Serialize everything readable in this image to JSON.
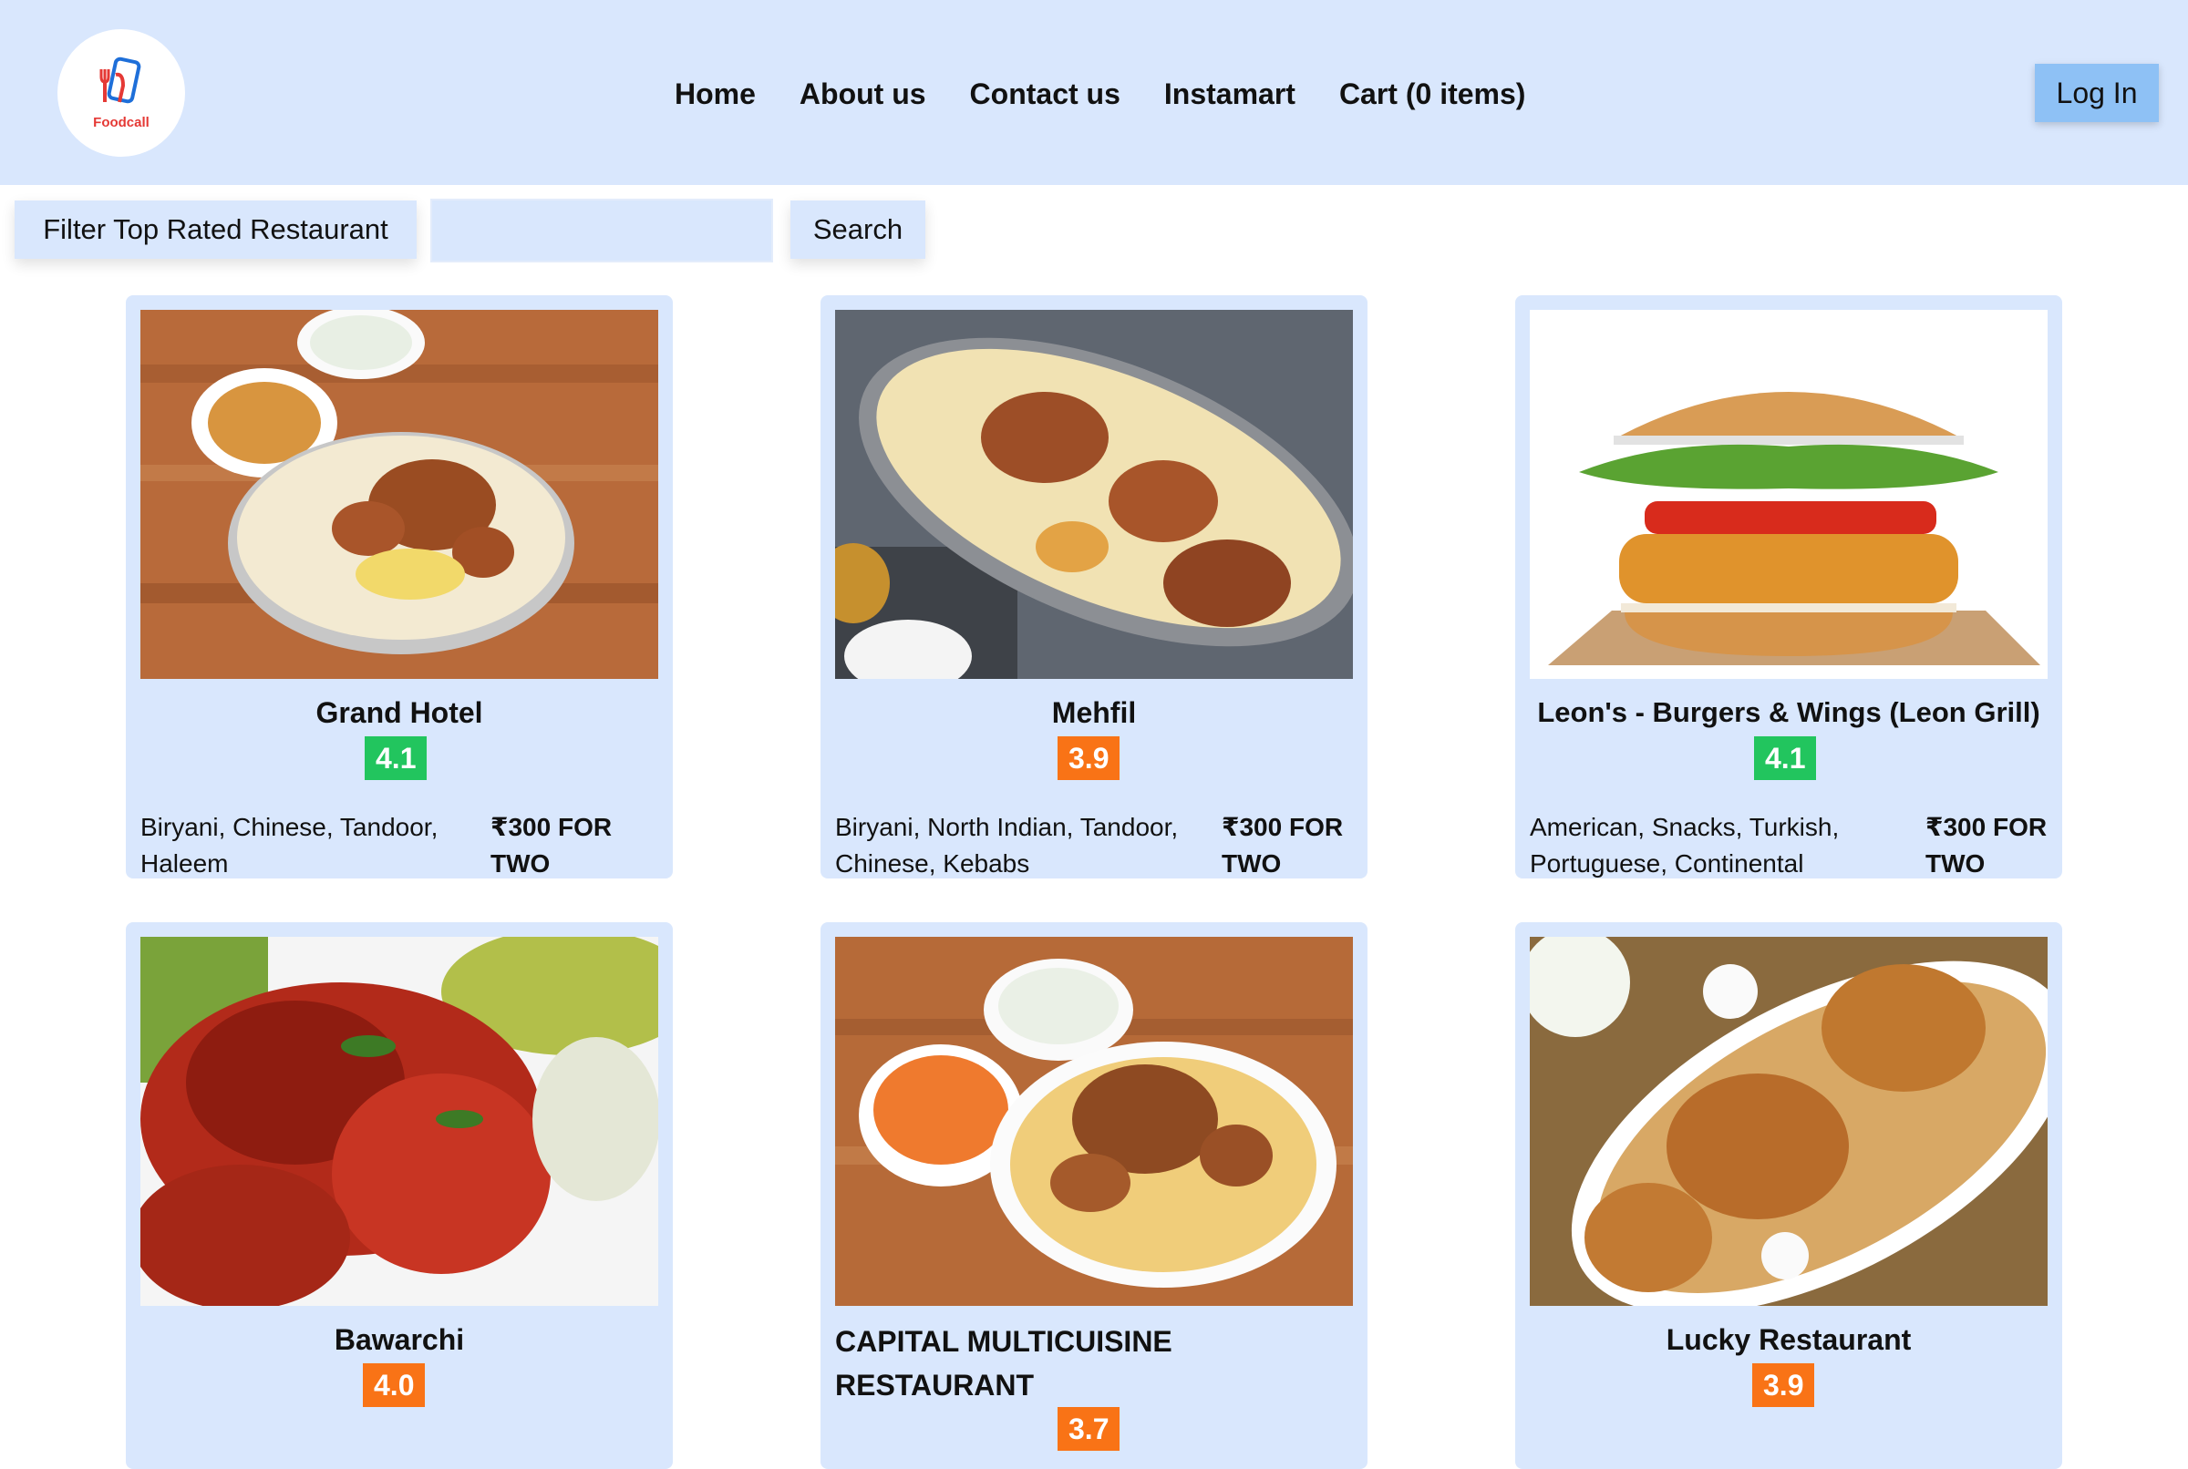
{
  "header": {
    "logo_text": "Foodcall",
    "nav": [
      "Home",
      "About us",
      "Contact us",
      "Instamart",
      "Cart (0 items)"
    ],
    "login_label": "Log In"
  },
  "toolbar": {
    "filter_label": "Filter Top Rated Restaurant",
    "search_value": "",
    "search_label": "Search"
  },
  "restaurants": [
    {
      "name": "Grand Hotel",
      "rating": "4.1",
      "cuisines": "Biryani, Chinese, Tandoor, Haleem",
      "price": "₹300 FOR TWO",
      "rating_color": "#22c55e"
    },
    {
      "name": "Mehfil",
      "rating": "3.9",
      "cuisines": "Biryani, North Indian, Tandoor, Chinese, Kebabs",
      "price": "₹300 FOR TWO",
      "rating_color": "#f97316"
    },
    {
      "name": "Leon's - Burgers & Wings (Leon Grill)",
      "rating": "4.1",
      "cuisines": "American, Snacks, Turkish, Portuguese, Continental",
      "price": "₹300 FOR TWO",
      "rating_color": "#22c55e"
    },
    {
      "name": "Bawarchi",
      "rating": "4.0",
      "cuisines": "",
      "price": "",
      "rating_color": "#f97316"
    },
    {
      "name": "CAPITAL MULTICUISINE RESTAURANT",
      "rating": "3.7",
      "cuisines": "",
      "price": "",
      "rating_color": "#f97316"
    },
    {
      "name": "Lucky Restaurant",
      "rating": "3.9",
      "cuisines": "",
      "price": "",
      "rating_color": "#f97316"
    }
  ],
  "colors": {
    "header_bg": "#d9e7fd",
    "login_bg": "#8ec1f5",
    "green": "#22c55e",
    "orange": "#f97316"
  }
}
